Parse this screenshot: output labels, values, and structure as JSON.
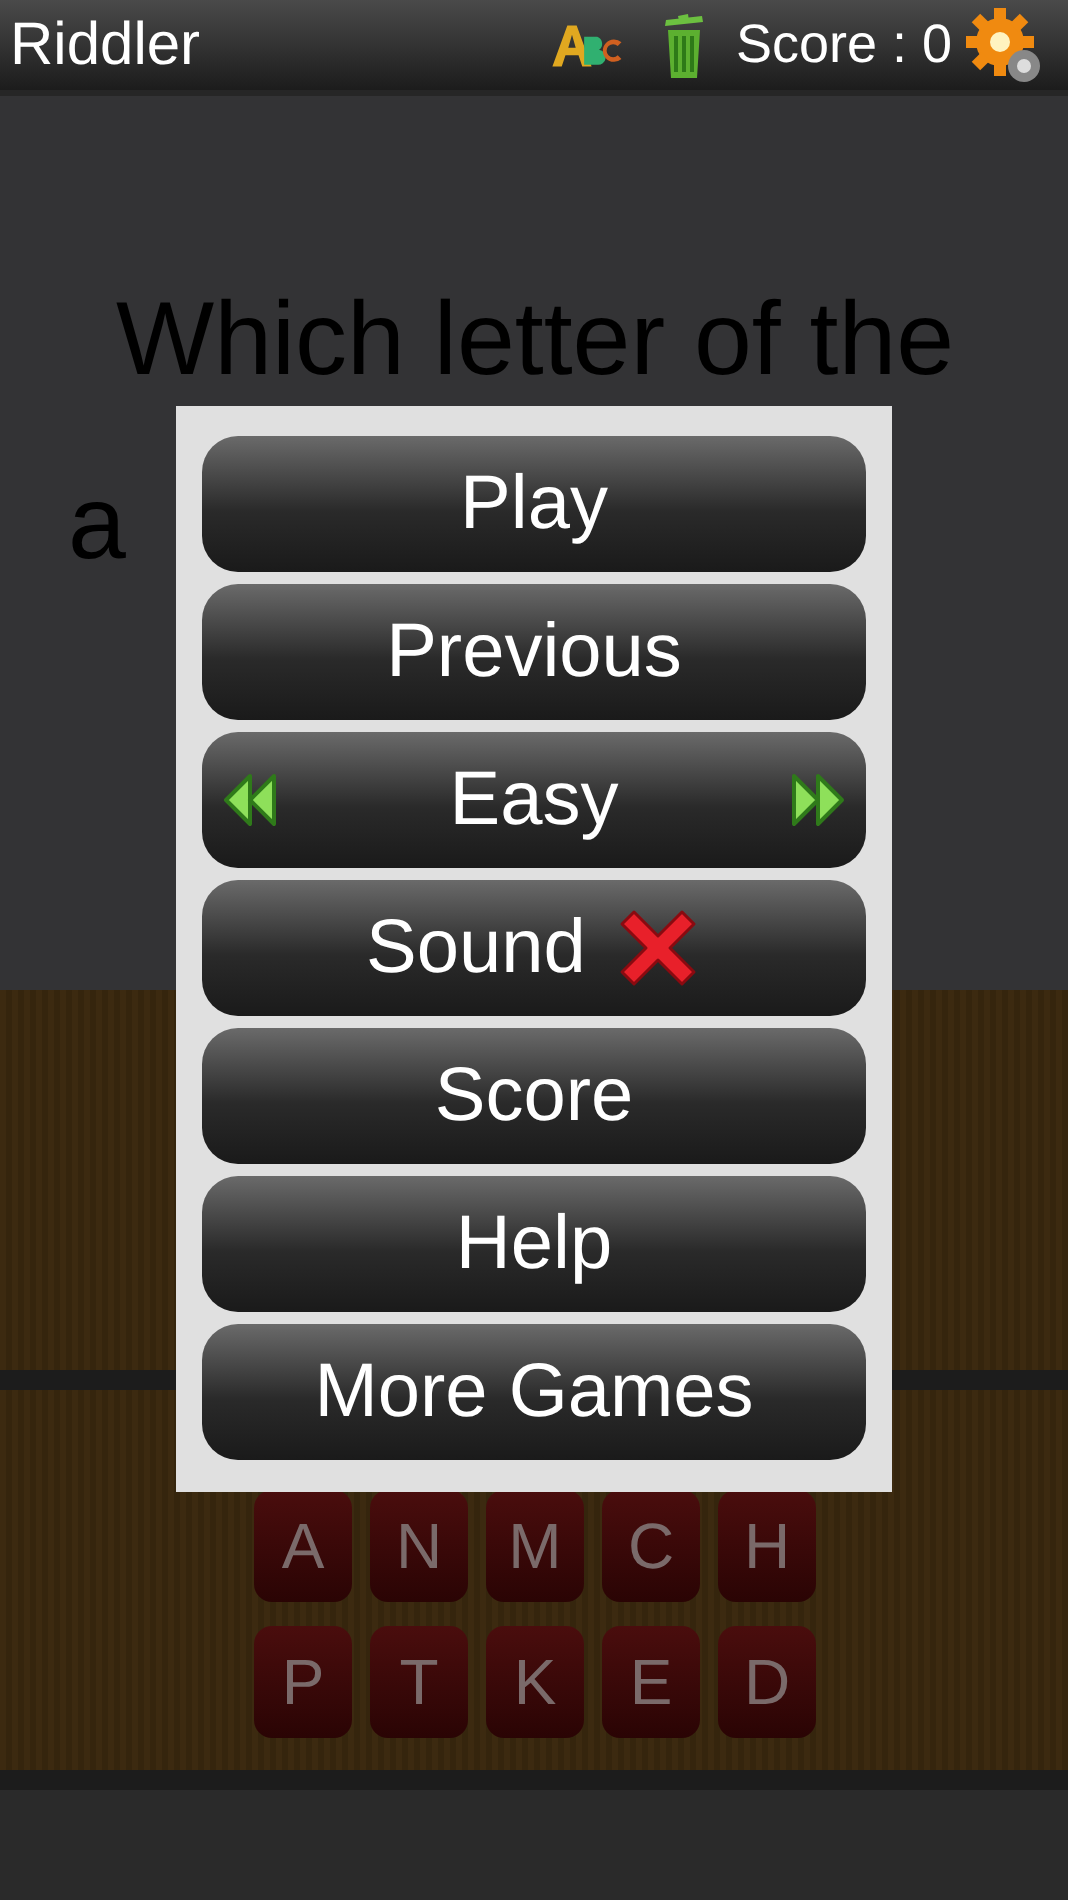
{
  "app_bar": {
    "title": "Riddler",
    "score": "Score : 0"
  },
  "question": [
    "Which letter of the",
    "a"
  ],
  "letter_tiles": [
    [
      "A",
      "N",
      "M",
      "C",
      "H"
    ],
    [
      "P",
      "T",
      "K",
      "E",
      "D"
    ]
  ],
  "menu": [
    {
      "kind": "plain",
      "label": "Play"
    },
    {
      "kind": "plain",
      "label": "Previous"
    },
    {
      "kind": "selector",
      "label": "Easy"
    },
    {
      "kind": "toggle",
      "label": "Sound",
      "on": false
    },
    {
      "kind": "plain",
      "label": "Score"
    },
    {
      "kind": "plain",
      "label": "Help"
    },
    {
      "kind": "plain",
      "label": "More Games"
    }
  ]
}
